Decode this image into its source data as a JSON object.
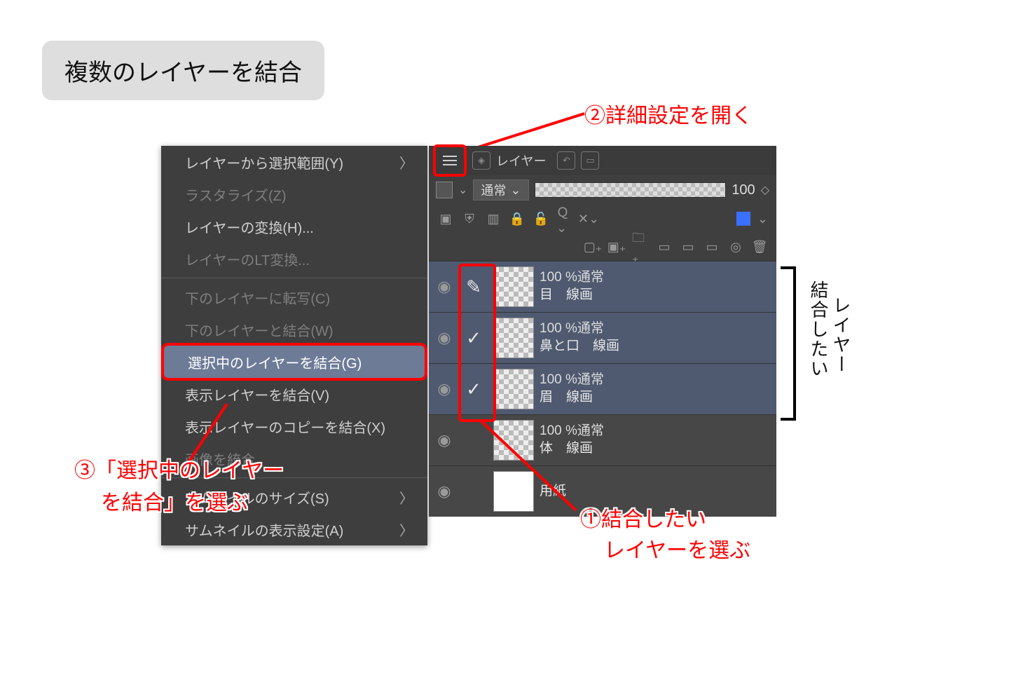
{
  "title": "複数のレイヤーを結合",
  "annotations": {
    "a_open_settings": "②詳細設定を開く",
    "a_merge_select_1": "③「選択中のレイヤー",
    "a_merge_select_2": "を結合」を選ぶ",
    "a_pick_layers_1": "①結合したい",
    "a_pick_layers_2": "レイヤーを選ぶ",
    "side_label_1": "結合したい",
    "side_label_2": "レイヤー"
  },
  "menu": [
    {
      "label": "レイヤーから選択範囲(Y)",
      "type": "row",
      "chev": true
    },
    {
      "label": "ラスタライズ(Z)",
      "type": "dim"
    },
    {
      "label": "レイヤーの変換(H)...",
      "type": "row"
    },
    {
      "label": "レイヤーのLT変換...",
      "type": "dim"
    },
    {
      "type": "sep"
    },
    {
      "label": "下のレイヤーに転写(C)",
      "type": "dim"
    },
    {
      "label": "下のレイヤーと結合(W)",
      "type": "dim"
    },
    {
      "label": "選択中のレイヤーを結合(G)",
      "type": "hl"
    },
    {
      "label": "表示レイヤーを結合(V)",
      "type": "row"
    },
    {
      "label": "表示レイヤーのコピーを結合(X)",
      "type": "row"
    },
    {
      "label": "画像を統合",
      "type": "dim"
    },
    {
      "type": "sep"
    },
    {
      "label": "サムネイルのサイズ(S)",
      "type": "row",
      "chev": true
    },
    {
      "label": "サムネイルの表示設定(A)",
      "type": "row",
      "chev": true
    }
  ],
  "panel": {
    "tab_label": "レイヤー",
    "blend_mode": "通常",
    "opacity": "100",
    "layers": [
      {
        "opacity": "100 %通常",
        "name": "目　線画",
        "sel": true,
        "mark": "pencil"
      },
      {
        "opacity": "100 %通常",
        "name": "鼻と口　線画",
        "sel": true,
        "mark": "check"
      },
      {
        "opacity": "100 %通常",
        "name": "眉　線画",
        "sel": true,
        "mark": "check"
      },
      {
        "opacity": "100 %通常",
        "name": "体　線画",
        "sel": false,
        "mark": ""
      },
      {
        "opacity": "",
        "name": "用紙",
        "sel": false,
        "mark": "",
        "white": true
      }
    ]
  }
}
